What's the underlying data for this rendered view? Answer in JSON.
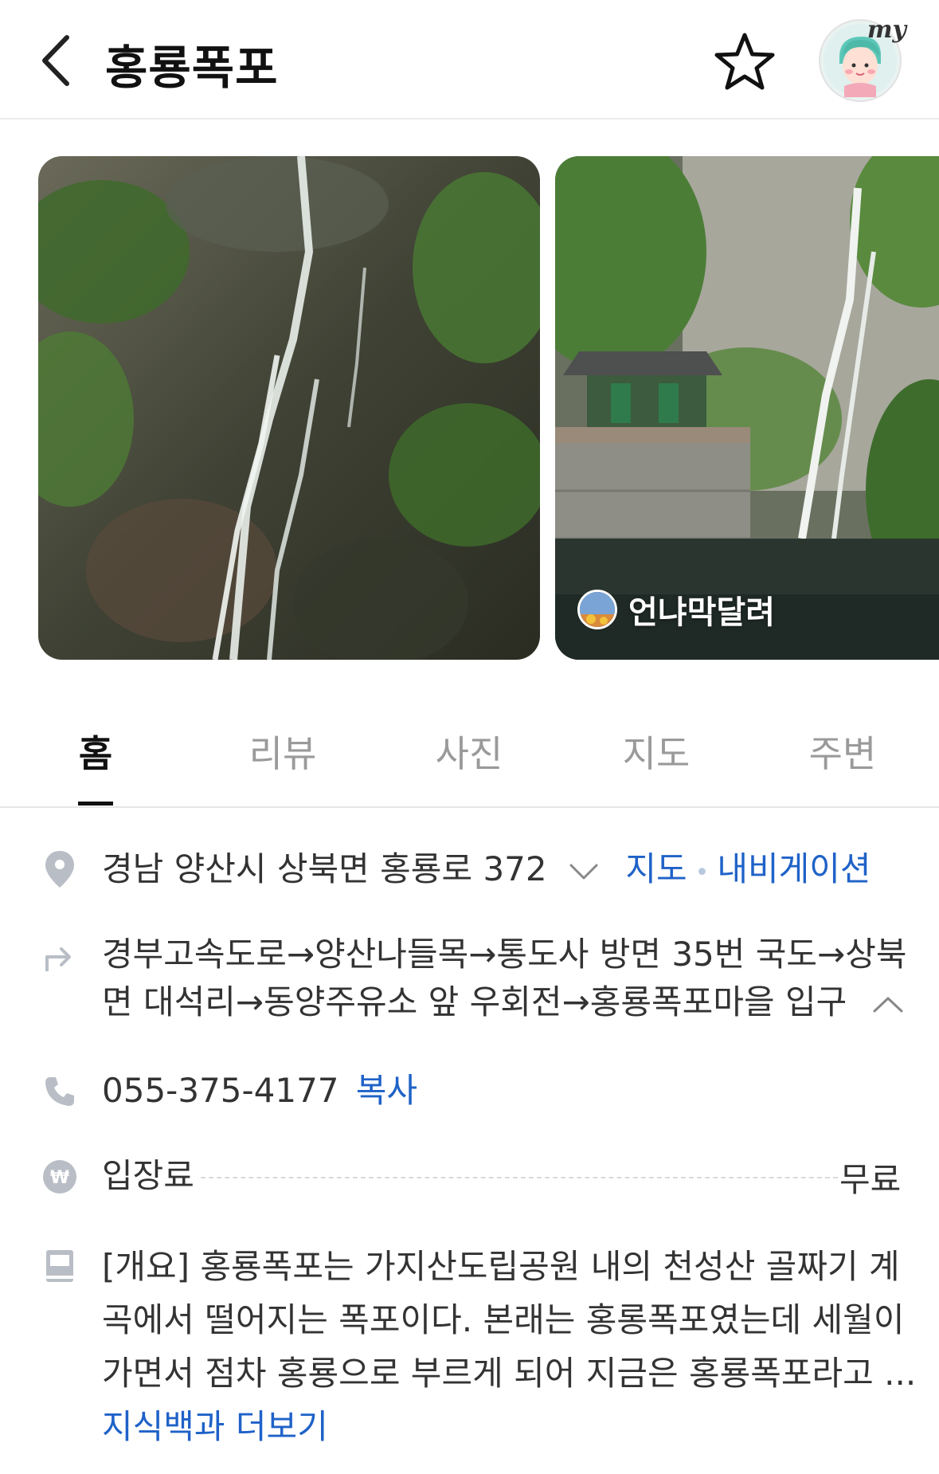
{
  "header": {
    "title": "홍룡폭포",
    "my_label": "my"
  },
  "photos": {
    "author_name": "언냐막달려"
  },
  "tabs": [
    {
      "label": "홈",
      "active": true
    },
    {
      "label": "리뷰",
      "active": false
    },
    {
      "label": "사진",
      "active": false
    },
    {
      "label": "지도",
      "active": false
    },
    {
      "label": "주변",
      "active": false
    }
  ],
  "info": {
    "address": "경남 양산시 상북면 홍룡로 372",
    "map_link": "지도",
    "navigation_link": "내비게이션",
    "directions_line1": "경부고속도로→양산나들목→통도사 방면 35번 국도→상북",
    "directions_line2": "면 대석리→동양주유소 앞 우회전→홍룡폭포마을 입구",
    "phone": "055-375-4177",
    "copy_label": "복사",
    "fee_label": "입장료",
    "fee_value": "무료",
    "overview_line1": "[개요] 홍룡폭포는 가지산도립공원 내의 천성산 골짜기 계",
    "overview_line2": "곡에서 떨어지는 폭포이다. 본래는 홍롱폭포였는데 세월이",
    "overview_line3": "가면서 점차 홍룡으로 부르게 되어 지금은 홍룡폭포라고 ...",
    "more_link": "지식백과 더보기"
  },
  "colors": {
    "link": "#1f62c8",
    "icon": "#b9bec6",
    "active_tab": "#111111",
    "inactive_tab": "#9a9a9a"
  }
}
